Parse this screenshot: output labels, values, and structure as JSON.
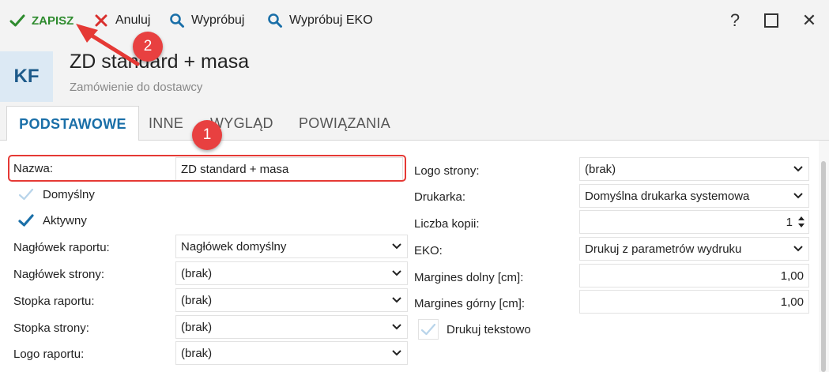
{
  "toolbar": {
    "save_label": "ZAPISZ",
    "cancel_label": "Anuluj",
    "try_label": "Wypróbuj",
    "try_eko_label": "Wypróbuj EKO",
    "help_label": "?",
    "close_label": "✕"
  },
  "header": {
    "badge": "KF",
    "title": "ZD standard + masa",
    "subtitle": "Zamówienie do dostawcy"
  },
  "tabs": [
    {
      "label": "PODSTAWOWE",
      "active": true
    },
    {
      "label": "INNE",
      "active": false
    },
    {
      "label": "WYGLĄD",
      "active": false
    },
    {
      "label": "POWIĄZANIA",
      "active": false
    }
  ],
  "left": {
    "name_label": "Nazwa:",
    "name_value": "ZD standard + masa",
    "default_label": "Domyślny",
    "default_checked": false,
    "active_label": "Aktywny",
    "active_checked": true,
    "report_header_label": "Nagłówek raportu:",
    "report_header_value": "Nagłówek domyślny",
    "page_header_label": "Nagłówek strony:",
    "page_header_value": "(brak)",
    "report_footer_label": "Stopka raportu:",
    "report_footer_value": "(brak)",
    "page_footer_label": "Stopka strony:",
    "page_footer_value": "(brak)",
    "report_logo_label": "Logo raportu:",
    "report_logo_value": "(brak)"
  },
  "right": {
    "page_logo_label": "Logo strony:",
    "page_logo_value": "(brak)",
    "printer_label": "Drukarka:",
    "printer_value": "Domyślna drukarka systemowa",
    "copies_label": "Liczba kopii:",
    "copies_value": "1",
    "eko_label": "EKO:",
    "eko_value": "Drukuj z parametrów wydruku",
    "margin_bottom_label": "Margines dolny [cm]:",
    "margin_bottom_value": "1,00",
    "margin_top_label": "Margines górny [cm]:",
    "margin_top_value": "1,00",
    "text_print_label": "Drukuj tekstowo",
    "text_print_checked": false
  },
  "annotations": {
    "badge_1": "1",
    "badge_2": "2"
  },
  "colors": {
    "accent": "#1a6fa8",
    "save_green": "#2e8b2e",
    "cancel_red": "#d9302e",
    "annotation_red": "#e53935"
  }
}
